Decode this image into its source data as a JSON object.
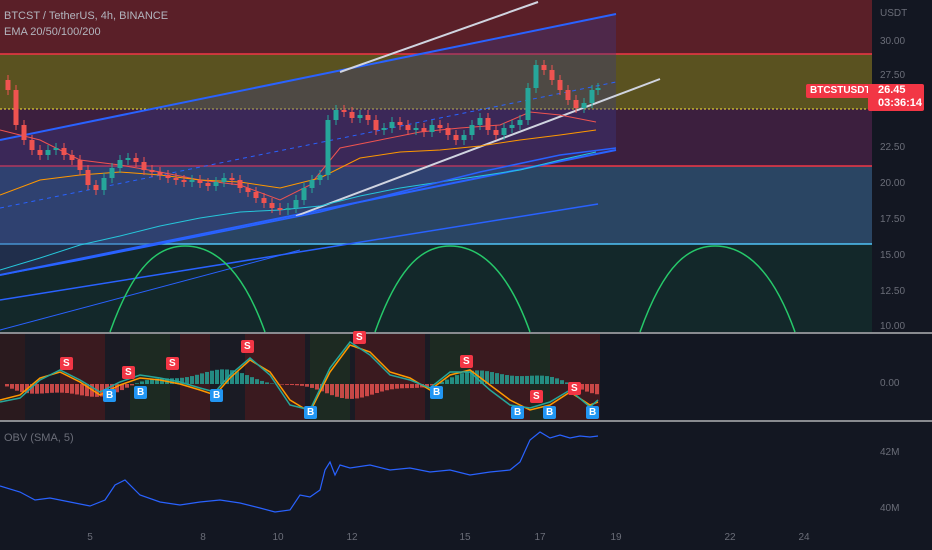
{
  "header": {
    "title": "BTCST / TetherUS, 4h, BINANCE",
    "indicator": "EMA 20/50/100/200"
  },
  "price_axis": {
    "currency": "USDT",
    "ticks": [
      "30.00",
      "27.50",
      "22.50",
      "20.00",
      "17.50",
      "15.00",
      "12.50",
      "10.00"
    ]
  },
  "last_price": {
    "symbol": "BTCSTUSDT",
    "value": "26.45",
    "countdown": "03:36:14"
  },
  "osc_panel": {
    "zero_label": "0.00",
    "sell_label": "S",
    "buy_label": "B"
  },
  "obv_panel": {
    "title": "OBV (SMA, 5)",
    "ticks": [
      "42M",
      "40M"
    ]
  },
  "date_axis": {
    "labels": [
      "5",
      "8",
      "10",
      "12",
      "15",
      "17",
      "19",
      "22",
      "24"
    ]
  },
  "colors": {
    "background": "#131722",
    "up": "#26a69a",
    "down": "#ef5350",
    "channel": "#2962ff",
    "obv": "#2962ff"
  },
  "chart_data": {
    "type": "candlestick",
    "last_close": 26.45,
    "levels": [
      28.8,
      25.0,
      21.0,
      15.7
    ],
    "obv_ticks": [
      "42M",
      "40M"
    ]
  }
}
